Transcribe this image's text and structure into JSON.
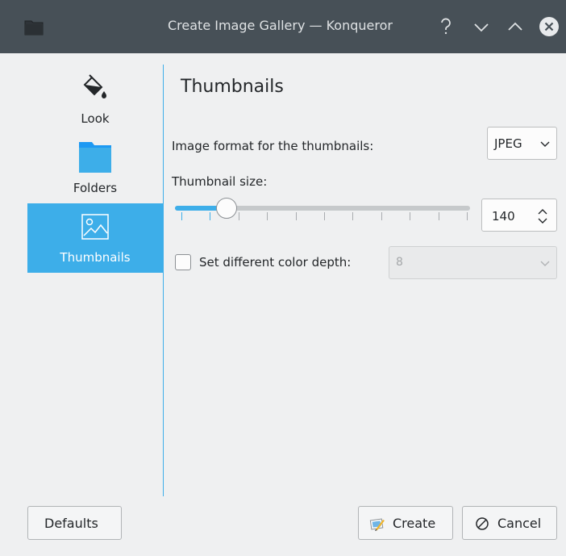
{
  "window": {
    "title": "Create Image Gallery — Konqueror",
    "help_glyph": "?",
    "minimize_glyph": "⌄",
    "maximize_glyph": "⌃",
    "close_glyph": "✕"
  },
  "sidebar": {
    "items": [
      {
        "label": "Look",
        "icon": "paint-bucket-icon",
        "active": false
      },
      {
        "label": "Folders",
        "icon": "folder-icon",
        "active": false
      },
      {
        "label": "Thumbnails",
        "icon": "image-icon",
        "active": true
      }
    ]
  },
  "page": {
    "heading": "Thumbnails",
    "format_label": "Image format for the thumbnails:",
    "format_value": "JPEG",
    "size_label": "Thumbnail size:",
    "size_value": "140",
    "size_fraction": 0.15,
    "color_depth_label": "Set different color depth:",
    "color_depth_checked": false,
    "color_depth_value": "8"
  },
  "buttons": {
    "defaults": "Defaults",
    "create": "Create",
    "cancel": "Cancel"
  },
  "colors": {
    "accent": "#3daee9",
    "titlebar": "#475057",
    "background": "#eff0f1"
  }
}
